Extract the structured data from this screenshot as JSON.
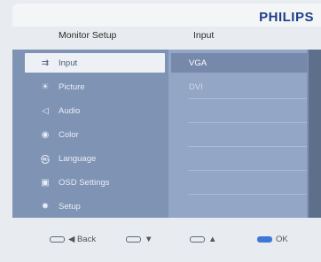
{
  "brand": "PHILIPS",
  "header": {
    "left": "Monitor Setup",
    "right": "Input"
  },
  "menu": [
    {
      "label": "Input",
      "icon": "input-icon",
      "glyph": "⇉",
      "selected": true
    },
    {
      "label": "Picture",
      "icon": "picture-icon",
      "glyph": "☀"
    },
    {
      "label": "Audio",
      "icon": "audio-icon",
      "glyph": "◁"
    },
    {
      "label": "Color",
      "icon": "color-icon",
      "glyph": "◉"
    },
    {
      "label": "Language",
      "icon": "language-icon",
      "glyph": "㉿"
    },
    {
      "label": "OSD Settings",
      "icon": "osd-settings-icon",
      "glyph": "▣"
    },
    {
      "label": "Setup",
      "icon": "setup-icon",
      "glyph": "✸"
    }
  ],
  "options": [
    {
      "label": "VGA",
      "selected": true
    },
    {
      "label": "DVI"
    }
  ],
  "footer": {
    "back": "◀ Back",
    "down": "▼",
    "up": "▲",
    "ok": "OK"
  },
  "colors": {
    "brand": "#1f3f8a",
    "panel": "#7f93b4",
    "selected": "#edf1f6",
    "ok_key": "#3d78d6"
  }
}
